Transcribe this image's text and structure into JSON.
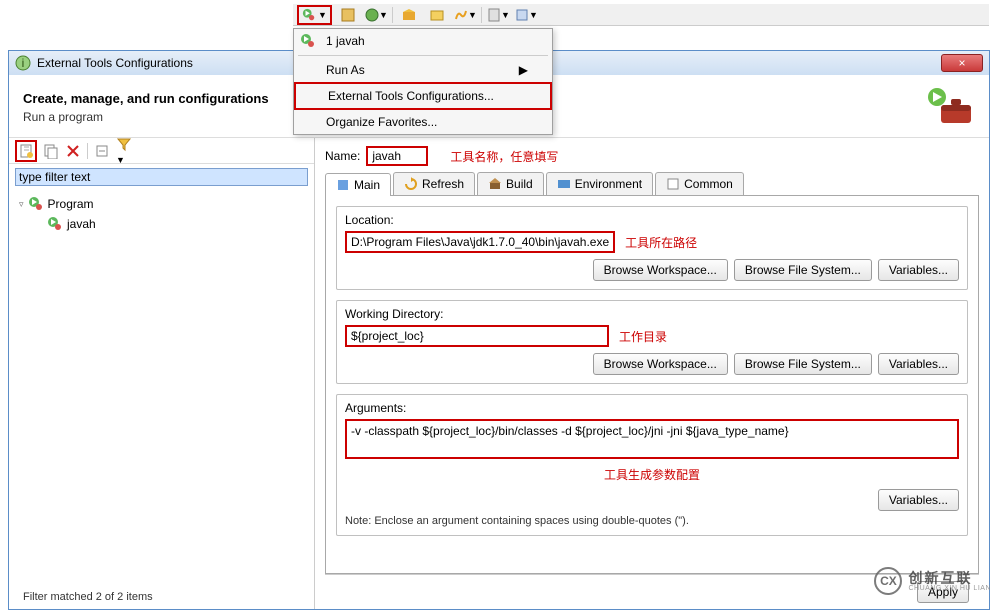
{
  "toolbar_dropdown": {
    "item1": "1 javah",
    "run_as": "Run As",
    "ext_config": "External Tools Configurations...",
    "org_fav": "Organize Favorites..."
  },
  "dialog": {
    "title": "External Tools Configurations",
    "close_glyph": "×",
    "header_title": "Create, manage, and run configurations",
    "header_sub": "Run a program"
  },
  "left": {
    "filter_placeholder": "type filter text",
    "tree_program": "Program",
    "tree_javah": "javah"
  },
  "status": "Filter matched 2 of 2 items",
  "right": {
    "name_label": "Name:",
    "name_value": "javah",
    "name_anno": "工具名称，任意填写",
    "tabs": {
      "main": "Main",
      "refresh": "Refresh",
      "build": "Build",
      "environment": "Environment",
      "common": "Common"
    },
    "location": {
      "label": "Location:",
      "value": "D:\\Program Files\\Java\\jdk1.7.0_40\\bin\\javah.exe",
      "anno": "工具所在路径",
      "btn_ws": "Browse Workspace...",
      "btn_fs": "Browse File System...",
      "btn_var": "Variables..."
    },
    "workdir": {
      "label": "Working Directory:",
      "value": "${project_loc}",
      "anno": "工作目录",
      "btn_ws": "Browse Workspace...",
      "btn_fs": "Browse File System...",
      "btn_var": "Variables..."
    },
    "args": {
      "label": "Arguments:",
      "value": "-v -classpath ${project_loc}/bin/classes -d ${project_loc}/jni -jni ${java_type_name}",
      "anno": "工具生成参数配置",
      "btn_var": "Variables...",
      "note": "Note: Enclose an argument containing spaces using double-quotes (\")."
    }
  },
  "footer": {
    "apply": "Apply"
  },
  "watermark": {
    "glyph": "CX",
    "zh": "创新互联",
    "en": "CHUANG XIN HU LIAN"
  }
}
